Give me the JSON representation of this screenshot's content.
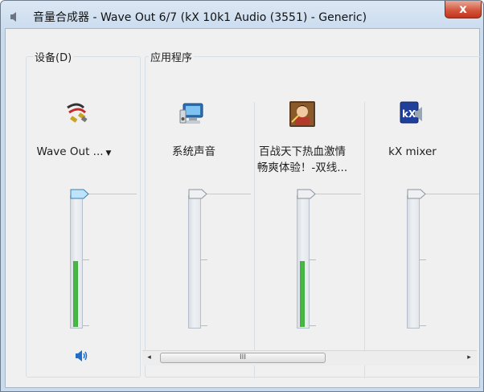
{
  "window": {
    "title": "音量合成器 - Wave Out 6/7 (kX 10k1 Audio (3551) - Generic)",
    "close_glyph": "x"
  },
  "groups": {
    "device_label": "设备(D)",
    "apps_label": "应用程序"
  },
  "channels": [
    {
      "id": "wave-out",
      "icon": "speaker-cable-icon",
      "name_line1": "Wave Out ...",
      "name_line2": "",
      "dropdown": true,
      "volume": 1.0,
      "level": 0.5,
      "muted": false
    },
    {
      "id": "system-sounds",
      "icon": "monitor-speaker-icon",
      "name_line1": "系统声音",
      "name_line2": "",
      "dropdown": false,
      "volume": 1.0,
      "level": 0.0,
      "muted": false
    },
    {
      "id": "game",
      "icon": "game-character-icon",
      "name_line1": "百战天下热血激情",
      "name_line2": "畅爽体验！-双线...",
      "dropdown": false,
      "volume": 1.0,
      "level": 0.5,
      "muted": false
    },
    {
      "id": "kx-mixer",
      "icon": "kx-mixer-icon",
      "name_line1": "kX mixer",
      "name_line2": "",
      "dropdown": false,
      "volume": 1.0,
      "level": 0.0,
      "muted": false
    }
  ],
  "scrollbar": {
    "left_arrow": "◂",
    "right_arrow": "▸",
    "grip": "III",
    "position": 0.0,
    "visible_fraction": 0.55
  },
  "colors": {
    "meter_green": "#4cbb45",
    "speaker_blue": "#1e6fc5",
    "close_red": "#cf4a30"
  }
}
